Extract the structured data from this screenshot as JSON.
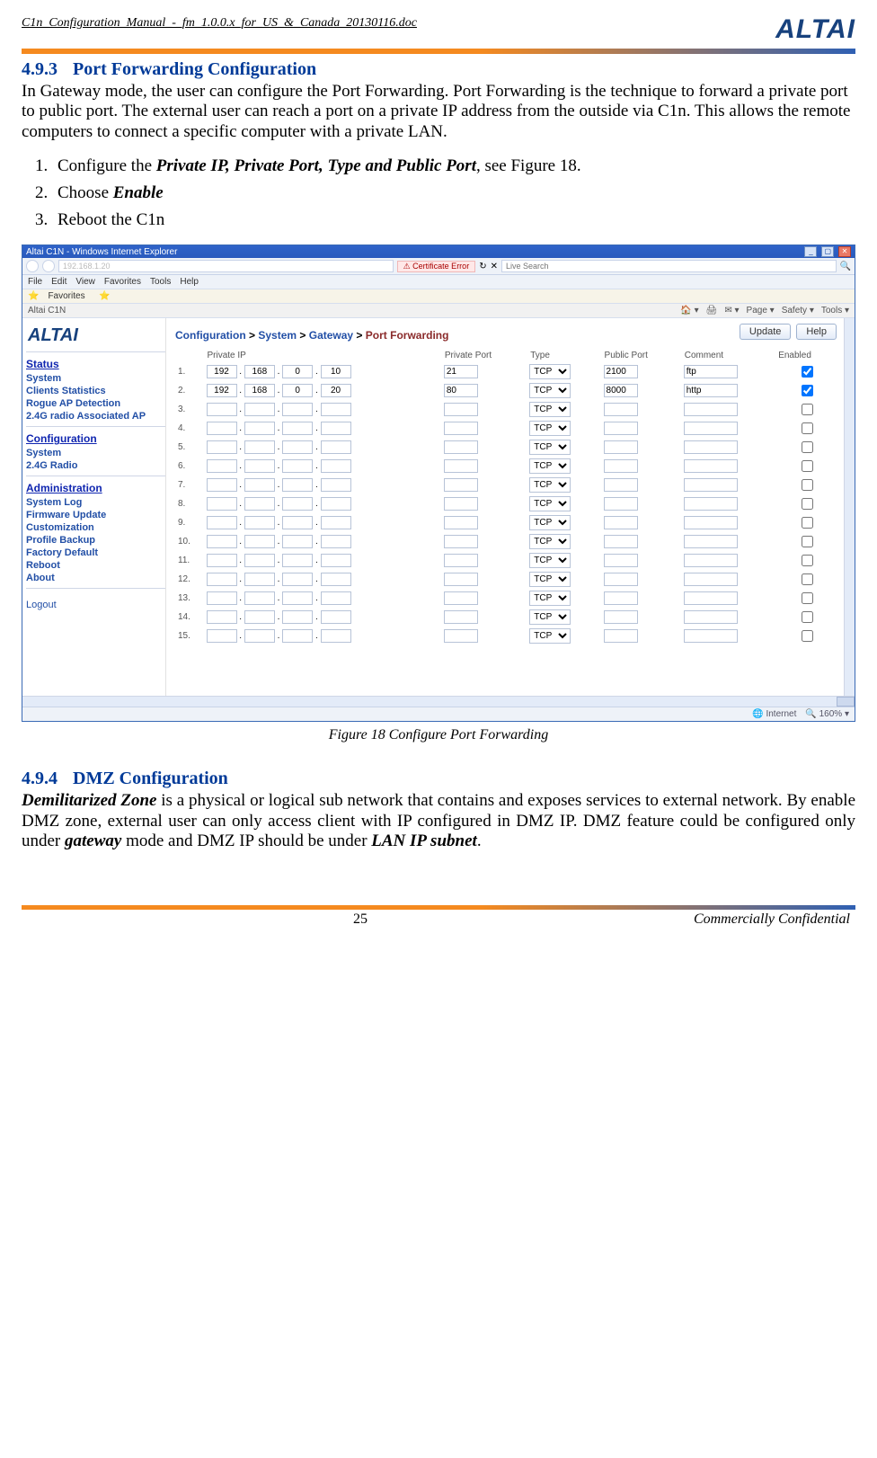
{
  "doc_header": "C1n_Configuration_Manual_-_fm_1.0.0.x_for_US_&_Canada_20130116.doc",
  "brand": "ALTAI",
  "section1": {
    "num": "4.9.3",
    "name": "Port Forwarding Configuration"
  },
  "para1": "In Gateway mode, the user can configure the Port Forwarding. Port Forwarding is the technique to forward a private port to public port. The external user can reach a port on a private IP address from the outside via C1n. This allows the remote computers to connect a specific computer with a private LAN.",
  "steps": [
    {
      "pre": "Configure the ",
      "em": "Private IP, Private Port, Type and Public Port",
      "post": ", see Figure 18."
    },
    {
      "pre": "Choose ",
      "em": "Enable",
      "post": ""
    },
    {
      "pre": "Reboot the C1n",
      "em": "",
      "post": ""
    }
  ],
  "ie": {
    "title": "Altai C1N - Windows Internet Explorer",
    "addr": "192.168.1.20",
    "cert": "Certificate Error",
    "search_placeholder": "Live Search",
    "menus": [
      "File",
      "Edit",
      "View",
      "Favorites",
      "Tools",
      "Help"
    ],
    "fav_label": "Favorites",
    "tab_label": "Altai C1N",
    "tab_tools": [
      "Page ▾",
      "Safety ▾",
      "Tools ▾"
    ],
    "status_internet": "Internet",
    "status_zoom": "160%"
  },
  "sidebar": {
    "status": "Status",
    "status_items": [
      "System",
      "Clients Statistics",
      "Rogue AP Detection",
      "2.4G radio Associated AP"
    ],
    "config": "Configuration",
    "config_items": [
      "System",
      "2.4G Radio"
    ],
    "admin": "Administration",
    "admin_items": [
      "System Log",
      "Firmware Update",
      "Customization",
      "Profile Backup",
      "Factory Default",
      "Reboot",
      "About"
    ],
    "logout": "Logout"
  },
  "breadcrumb": {
    "a": "Configuration",
    "b": "System",
    "c": "Gateway",
    "d": "Port Forwarding"
  },
  "buttons": {
    "update": "Update",
    "help": "Help"
  },
  "table": {
    "headers": {
      "ip": "Private IP",
      "pport": "Private Port",
      "type": "Type",
      "pub": "Public Port",
      "cmt": "Comment",
      "en": "Enabled"
    },
    "type_default": "TCP",
    "rows": [
      {
        "n": "1.",
        "ip": [
          "192",
          "168",
          "0",
          "10"
        ],
        "pp": "21",
        "type": "TCP",
        "pub": "2100",
        "cmt": "ftp",
        "en": true
      },
      {
        "n": "2.",
        "ip": [
          "192",
          "168",
          "0",
          "20"
        ],
        "pp": "80",
        "type": "TCP",
        "pub": "8000",
        "cmt": "http",
        "en": true
      },
      {
        "n": "3.",
        "ip": [
          "",
          "",
          "",
          ""
        ],
        "pp": "",
        "type": "TCP",
        "pub": "",
        "cmt": "",
        "en": false
      },
      {
        "n": "4.",
        "ip": [
          "",
          "",
          "",
          ""
        ],
        "pp": "",
        "type": "TCP",
        "pub": "",
        "cmt": "",
        "en": false
      },
      {
        "n": "5.",
        "ip": [
          "",
          "",
          "",
          ""
        ],
        "pp": "",
        "type": "TCP",
        "pub": "",
        "cmt": "",
        "en": false
      },
      {
        "n": "6.",
        "ip": [
          "",
          "",
          "",
          ""
        ],
        "pp": "",
        "type": "TCP",
        "pub": "",
        "cmt": "",
        "en": false
      },
      {
        "n": "7.",
        "ip": [
          "",
          "",
          "",
          ""
        ],
        "pp": "",
        "type": "TCP",
        "pub": "",
        "cmt": "",
        "en": false
      },
      {
        "n": "8.",
        "ip": [
          "",
          "",
          "",
          ""
        ],
        "pp": "",
        "type": "TCP",
        "pub": "",
        "cmt": "",
        "en": false
      },
      {
        "n": "9.",
        "ip": [
          "",
          "",
          "",
          ""
        ],
        "pp": "",
        "type": "TCP",
        "pub": "",
        "cmt": "",
        "en": false
      },
      {
        "n": "10.",
        "ip": [
          "",
          "",
          "",
          ""
        ],
        "pp": "",
        "type": "TCP",
        "pub": "",
        "cmt": "",
        "en": false
      },
      {
        "n": "11.",
        "ip": [
          "",
          "",
          "",
          ""
        ],
        "pp": "",
        "type": "TCP",
        "pub": "",
        "cmt": "",
        "en": false
      },
      {
        "n": "12.",
        "ip": [
          "",
          "",
          "",
          ""
        ],
        "pp": "",
        "type": "TCP",
        "pub": "",
        "cmt": "",
        "en": false
      },
      {
        "n": "13.",
        "ip": [
          "",
          "",
          "",
          ""
        ],
        "pp": "",
        "type": "TCP",
        "pub": "",
        "cmt": "",
        "en": false
      },
      {
        "n": "14.",
        "ip": [
          "",
          "",
          "",
          ""
        ],
        "pp": "",
        "type": "TCP",
        "pub": "",
        "cmt": "",
        "en": false
      },
      {
        "n": "15.",
        "ip": [
          "",
          "",
          "",
          ""
        ],
        "pp": "",
        "type": "TCP",
        "pub": "",
        "cmt": "",
        "en": false
      }
    ]
  },
  "fig_caption": "Figure 18    Configure Port Forwarding",
  "section2": {
    "num": "4.9.4",
    "name": "DMZ Configuration"
  },
  "para2_lead": "Demilitarized Zone",
  "para2_body": " is a physical or logical sub network that contains and exposes services to external network. By enable DMZ zone, external user can only access client with IP configured in DMZ IP. DMZ feature could be configured only under ",
  "para2_g": "gateway",
  "para2_mid": " mode and DMZ IP should be under ",
  "para2_lan": "LAN IP subnet",
  "para2_end": ".",
  "footer": {
    "page": "25",
    "conf": "Commercially Confidential"
  }
}
